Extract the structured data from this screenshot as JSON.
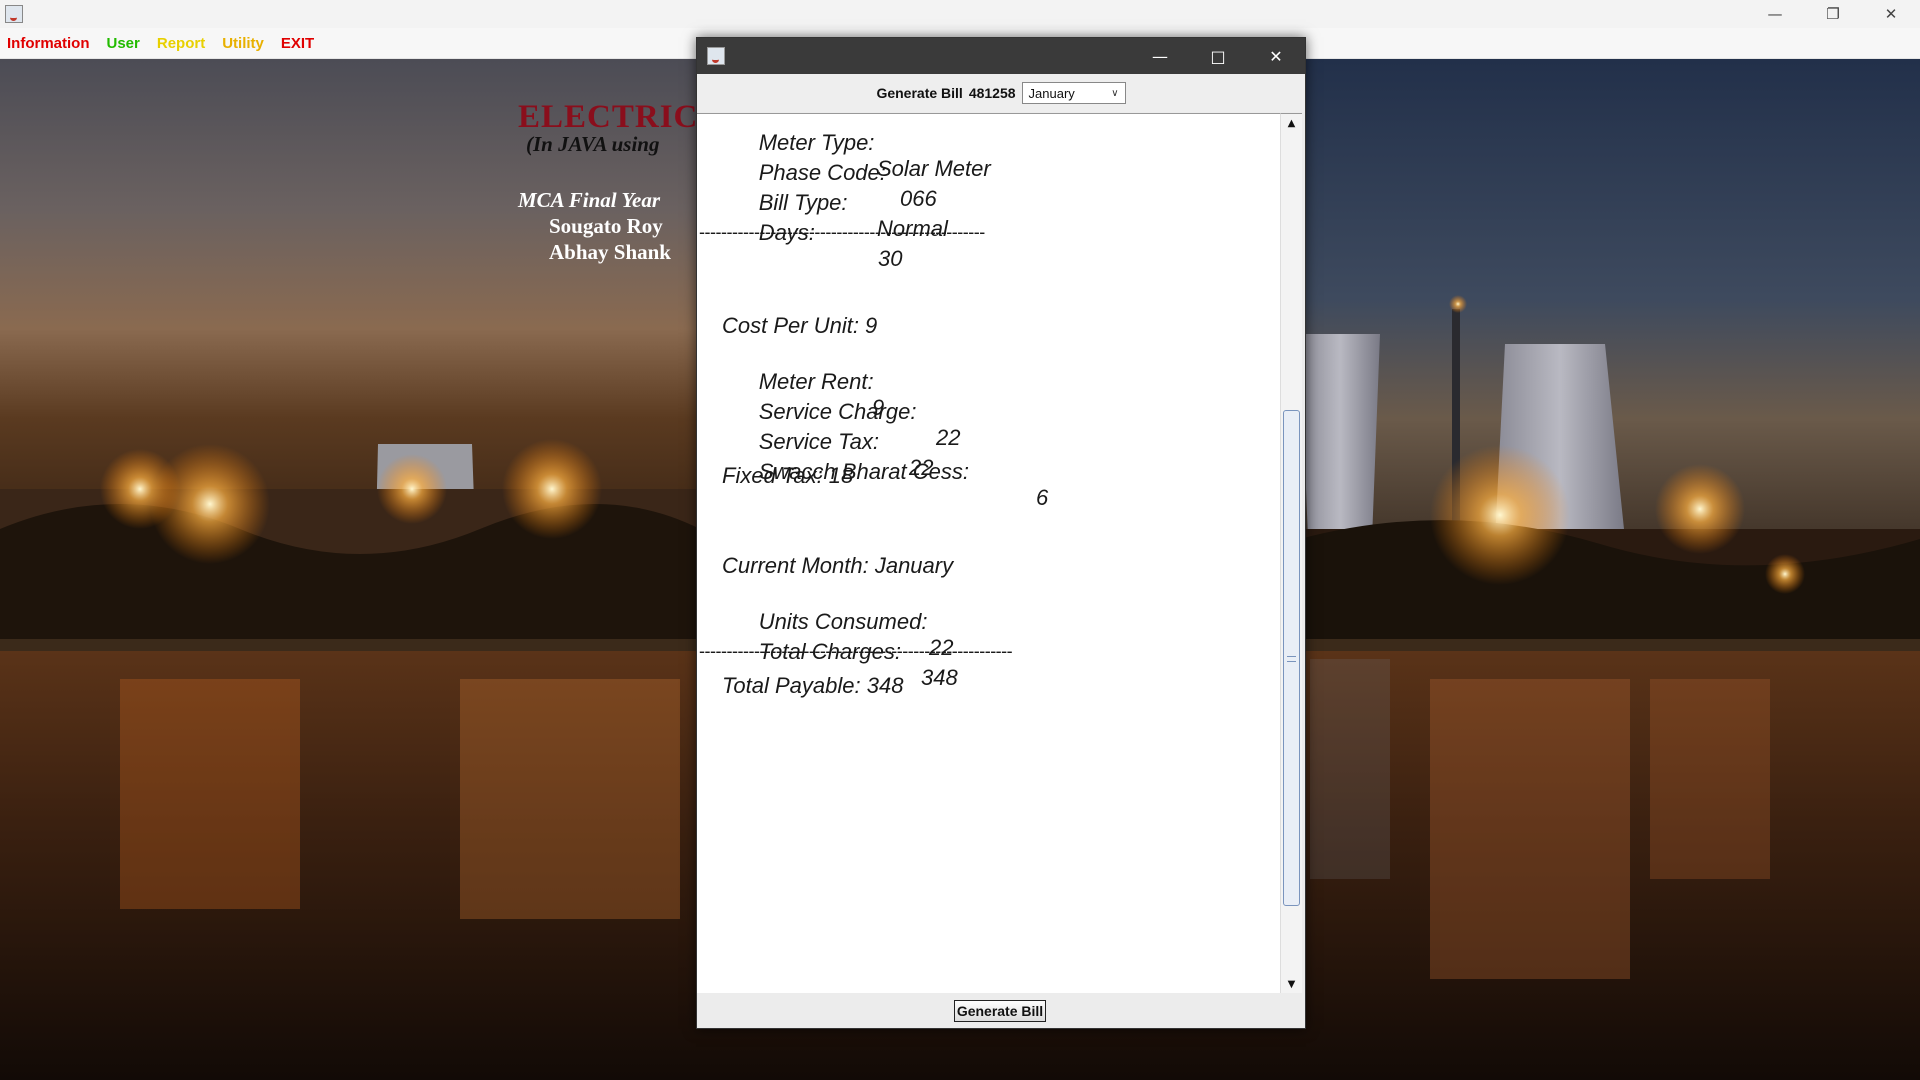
{
  "menu": {
    "items": [
      {
        "label": "Information",
        "color": "#e00000"
      },
      {
        "label": "User",
        "color": "#22bb00"
      },
      {
        "label": "Report",
        "color": "#e8d000"
      },
      {
        "label": "Utility",
        "color": "#e8b000"
      },
      {
        "label": "EXIT",
        "color": "#e00000"
      }
    ]
  },
  "background": {
    "title": "ELECTRIC",
    "subtitle": "(In JAVA using",
    "credit_1": "MCA Final Year",
    "credit_2": "Sougato Roy",
    "credit_3": "Abhay Shank"
  },
  "dialog": {
    "header_label": "Generate Bill",
    "meter_number": "481258",
    "selected_month": "January",
    "generate_button": "Generate Bill",
    "bill": {
      "meter_type_label": "Meter Type:",
      "meter_type_value": "Solar Meter",
      "phase_code_label": "Phase Code:",
      "phase_code_value": "066",
      "bill_type_label": "Bill Type:",
      "bill_type_value": "Normal",
      "days_label": "Days:",
      "days_value": "30",
      "separator_1": "----------------------------------------------------",
      "cost_per_unit": "Cost Per Unit: 9",
      "meter_rent_label": "Meter Rent:",
      "meter_rent_value": "9",
      "service_charge_label": "Service Charge:",
      "service_charge_value": "22",
      "service_tax_label": "Service Tax:",
      "service_tax_value": "22",
      "swacch_label": "Swacch Bharat Cess:",
      "swacch_value": "6",
      "fixed_tax": "Fixed Tax: 18",
      "current_month": "Current Month: January",
      "units_label": "Units Consumed:",
      "units_value": "22",
      "total_charges_label": "Total Charges:",
      "total_charges_value": "348",
      "separator_2": "---------------------------------------------------------",
      "total_payable": "Total Payable: 348"
    }
  }
}
